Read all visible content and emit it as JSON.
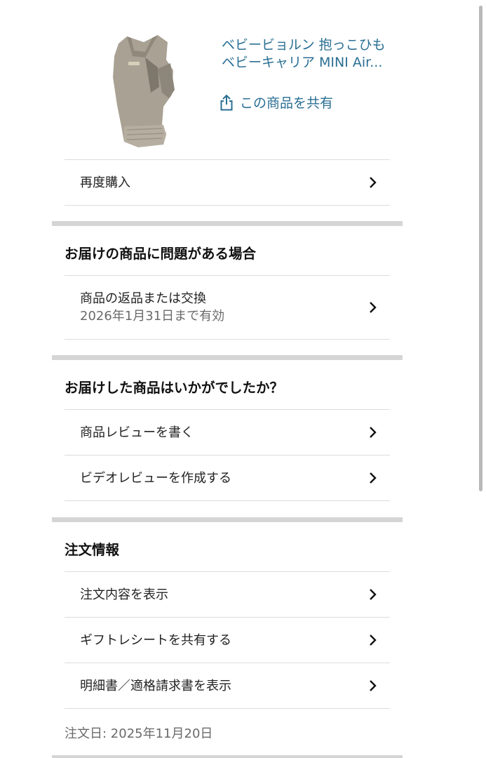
{
  "product": {
    "title": "ベビービョルン 抱っこひも ベビーキャリア MINI Air...",
    "share_label": "この商品を共有"
  },
  "rebuy": {
    "label": "再度購入"
  },
  "problem_section": {
    "heading": "お届けの商品に問題がある場合",
    "return_label": "商品の返品または交換",
    "return_deadline": "2026年1月31日まで有効"
  },
  "review_section": {
    "heading": "お届けした商品はいかがでしたか？",
    "items": [
      {
        "label": "商品レビューを書く"
      },
      {
        "label": "ビデオレビューを作成する"
      }
    ]
  },
  "order_section": {
    "heading": "注文情報",
    "items": [
      {
        "label": "注文内容を表示"
      },
      {
        "label": "ギフトレシートを共有する"
      },
      {
        "label": "明細書／適格請求書を表示"
      }
    ],
    "order_date": "注文日: 2025年11月20日"
  },
  "colors": {
    "link": "#2a6f93",
    "divider": "#d5d5d5",
    "row_border": "#dcdcdc"
  }
}
